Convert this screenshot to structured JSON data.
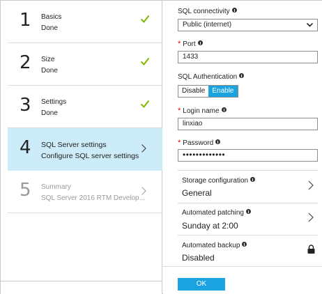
{
  "steps": [
    {
      "number": "1",
      "title": "Basics",
      "subtitle": "Done",
      "state": "done"
    },
    {
      "number": "2",
      "title": "Size",
      "subtitle": "Done",
      "state": "done"
    },
    {
      "number": "3",
      "title": "Settings",
      "subtitle": "Done",
      "state": "done"
    },
    {
      "number": "4",
      "title": "SQL Server settings",
      "subtitle": "Configure SQL server settings",
      "state": "active"
    },
    {
      "number": "5",
      "title": "Summary",
      "subtitle": "SQL Server 2016 RTM Develop...",
      "state": "disabled"
    }
  ],
  "form": {
    "connectivity": {
      "label": "SQL connectivity",
      "value": "Public (internet)"
    },
    "port": {
      "label": "Port",
      "value": "1433"
    },
    "auth": {
      "label": "SQL Authentication",
      "disable_label": "Disable",
      "enable_label": "Enable",
      "selected": "Enable"
    },
    "login": {
      "label": "Login name",
      "value": "linxiao"
    },
    "password": {
      "label": "Password",
      "value": "•••••••••••••"
    },
    "storage": {
      "title": "Storage configuration",
      "value": "General"
    },
    "patching": {
      "title": "Automated patching",
      "value": "Sunday at 2:00"
    },
    "backup": {
      "title": "Automated backup",
      "value": "Disabled"
    },
    "ok_label": "OK"
  },
  "colors": {
    "accent": "#1aa3e0",
    "active_step_bg": "#ccecfa",
    "check_green": "#7fba00",
    "required_red": "#dd0000"
  },
  "icons": {
    "check": "check-icon",
    "chevron": "chevron-right-icon",
    "info": "info-icon",
    "lock": "lock-icon",
    "caret": "chevron-down-icon"
  }
}
